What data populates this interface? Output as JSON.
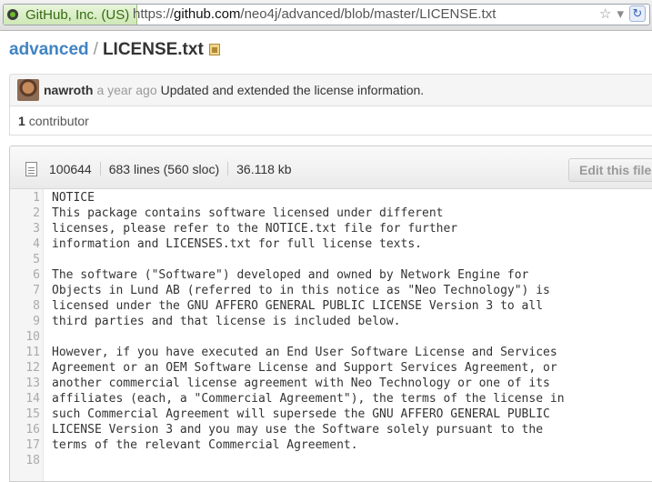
{
  "browser": {
    "identity": "GitHub, Inc. (US)",
    "url_prefix": "https://",
    "url_host": "github.com",
    "url_path": "/neo4j/advanced/blob/master/LICENSE.txt",
    "star_icon": "☆",
    "dropdown_icon": "▾",
    "reload_icon": "↻"
  },
  "breadcrumb": {
    "repo": "advanced",
    "separator": "/",
    "file": "LICENSE.txt"
  },
  "commit": {
    "author": "nawroth",
    "time": "a year ago",
    "message": "Updated and extended the license information."
  },
  "contributors": {
    "count": "1",
    "label": "contributor"
  },
  "file": {
    "mode": "100644",
    "lines": "683 lines (560 sloc)",
    "size": "36.118 kb",
    "edit_label": "Edit this file"
  },
  "code_lines": [
    {
      "n": "1",
      "text": "NOTICE"
    },
    {
      "n": "2",
      "text": "This package contains software licensed under different"
    },
    {
      "n": "3",
      "text": "licenses, please refer to the NOTICE.txt file for further"
    },
    {
      "n": "4",
      "text": "information and LICENSES.txt for full license texts."
    },
    {
      "n": "5",
      "text": ""
    },
    {
      "n": "6",
      "text": "The software (\"Software\") developed and owned by Network Engine for"
    },
    {
      "n": "7",
      "text": "Objects in Lund AB (referred to in this notice as \"Neo Technology\") is"
    },
    {
      "n": "8",
      "text": "licensed under the GNU AFFERO GENERAL PUBLIC LICENSE Version 3 to all"
    },
    {
      "n": "9",
      "text": "third parties and that license is included below."
    },
    {
      "n": "10",
      "text": ""
    },
    {
      "n": "11",
      "text": "However, if you have executed an End User Software License and Services"
    },
    {
      "n": "12",
      "text": "Agreement or an OEM Software License and Support Services Agreement, or"
    },
    {
      "n": "13",
      "text": "another commercial license agreement with Neo Technology or one of its"
    },
    {
      "n": "14",
      "text": "affiliates (each, a \"Commercial Agreement\"), the terms of the license in"
    },
    {
      "n": "15",
      "text": "such Commercial Agreement will supersede the GNU AFFERO GENERAL PUBLIC"
    },
    {
      "n": "16",
      "text": "LICENSE Version 3 and you may use the Software solely pursuant to the"
    },
    {
      "n": "17",
      "text": "terms of the relevant Commercial Agreement."
    },
    {
      "n": "18",
      "text": ""
    }
  ]
}
